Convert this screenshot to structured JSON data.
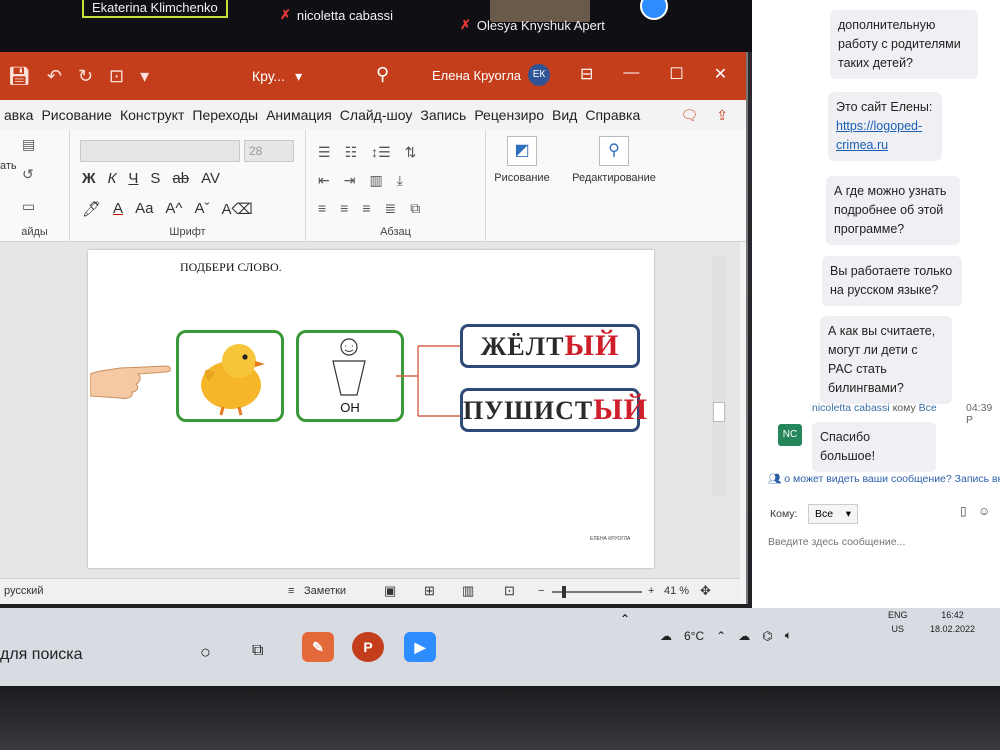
{
  "zoom": {
    "participants": [
      {
        "name": "Ekaterina Klimchenko",
        "muted": false
      },
      {
        "name": "nicoletta cabassi",
        "muted": true
      },
      {
        "name": "Olesya Knyshuk Apert",
        "muted": true
      }
    ]
  },
  "ppt": {
    "doc_title": "Кру...",
    "user_name": "Елена Круогла",
    "user_initials": "ЕК",
    "tabs": [
      "авка",
      "Рисование",
      "Конструкт",
      "Переходы",
      "Анимация",
      "Слайд-шоу",
      "Запись",
      "Рецензиро",
      "Вид",
      "Справка"
    ],
    "font_size": "28",
    "groups": {
      "left": "айды",
      "font": "Шрифт",
      "paragraph": "Абзац"
    },
    "left_label": "ать",
    "format_buttons": [
      "Ж",
      "К",
      "Ч",
      "S",
      "ab",
      "AV"
    ],
    "drawing_label": "Рисование",
    "editing_label": "Редактирование",
    "slide": {
      "title": "ПОДБЕРИ СЛОВО.",
      "pronoun": "ОН",
      "words": [
        {
          "stem": "ЖЁЛТ",
          "ending": "ЫЙ"
        },
        {
          "stem": "ПУШИСТ",
          "ending": "ЫЙ"
        }
      ],
      "logo": "ЕЛЕНА КРУОГЛА"
    },
    "status": {
      "language": "русский",
      "notes": "Заметки",
      "zoom": "41 %",
      "plus": "+",
      "minus": "−"
    }
  },
  "chat": {
    "messages": [
      {
        "text": "дополнительную работу с родителями таких детей?"
      },
      {
        "text": "Это сайт Елены:",
        "link": "https://logoped-crimea.ru"
      },
      {
        "text": "А где можно узнать подробнее об этой программе?"
      },
      {
        "text": "Вы работаете только на русском языке?"
      },
      {
        "text": "А как вы считаете, могут ли дети с РАС стать билингвами?"
      }
    ],
    "last_sender": "nicoletta cabassi",
    "last_to": "кому",
    "last_to_target": "Все",
    "last_time": "04:39 P",
    "last_initials": "NC",
    "last_text": "Спасибо большое!",
    "note": "о может видеть ваши сообщение? Запись вкл",
    "to_label": "Кому:",
    "to_value": "Все",
    "input_placeholder": "Введите здесь сообщение..."
  },
  "taskbar": {
    "search_text": "для поиска",
    "temperature": "6°C",
    "lang_top": "ENG",
    "lang_bottom": "US",
    "time": "16:42",
    "date": "18.02.2022"
  },
  "colors": {
    "ppt_accent": "#c43e1c",
    "frame_green": "#3a9a3a",
    "word_border": "#2e4a78",
    "ending_red": "#cf1f2a",
    "zoom_blue": "#2d8cff"
  }
}
